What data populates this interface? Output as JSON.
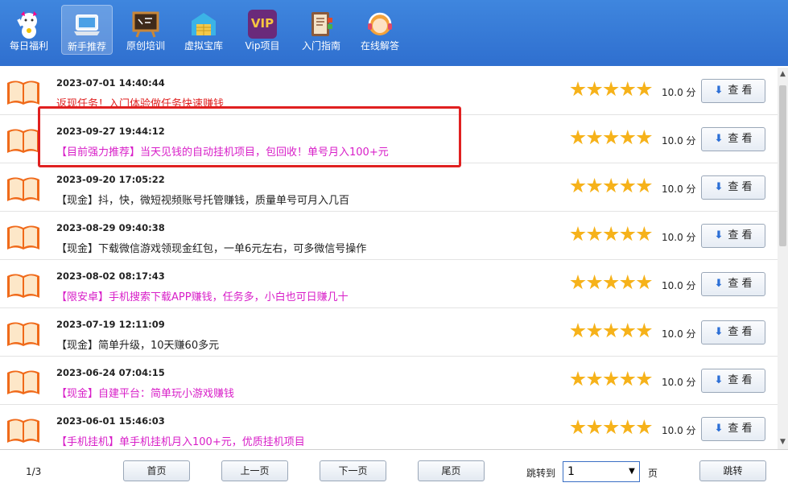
{
  "toolbar": {
    "items": [
      {
        "label": "每日福利",
        "icon": "lucky-cat-icon",
        "active": false
      },
      {
        "label": "新手推荐",
        "icon": "laptop-icon",
        "active": true
      },
      {
        "label": "原创培训",
        "icon": "chalkboard-icon",
        "active": false
      },
      {
        "label": "虚拟宝库",
        "icon": "warehouse-icon",
        "active": false
      },
      {
        "label": "Vip项目",
        "icon": "vip-icon",
        "active": false,
        "icon_text": "VIP"
      },
      {
        "label": "入门指南",
        "icon": "guide-book-icon",
        "active": false
      },
      {
        "label": "在线解答",
        "icon": "support-agent-icon",
        "active": false
      }
    ]
  },
  "list": {
    "rows": [
      {
        "date": "2023-07-01 14:40:44",
        "title": "返现任务！入门体验做任务快速赚钱",
        "color": "#e02020",
        "score": "10.0 分",
        "view": "查 看",
        "rating": 5
      },
      {
        "date": "2023-09-27 19:44:12",
        "title": "【目前强力推荐】当天见钱的自动挂机项目，包回收！单号月入100+元",
        "color": "#d81ec8",
        "score": "10.0 分",
        "view": "查 看",
        "rating": 5
      },
      {
        "date": "2023-09-20 17:05:22",
        "title": "【现金】抖，快，微短视频账号托管赚钱，质量单号可月入几百",
        "color": "#222222",
        "score": "10.0 分",
        "view": "查 看",
        "rating": 5
      },
      {
        "date": "2023-08-29 09:40:38",
        "title": "【现金】下载微信游戏领现金红包，一单6元左右，可多微信号操作",
        "color": "#222222",
        "score": "10.0 分",
        "view": "查 看",
        "rating": 5
      },
      {
        "date": "2023-08-02 08:17:43",
        "title": "【限安卓】手机搜索下载APP赚钱，任务多，小白也可日赚几十",
        "color": "#d81ec8",
        "score": "10.0 分",
        "view": "查 看",
        "rating": 5
      },
      {
        "date": "2023-07-19 12:11:09",
        "title": "【现金】简单升级，10天赚60多元",
        "color": "#222222",
        "score": "10.0 分",
        "view": "查 看",
        "rating": 5
      },
      {
        "date": "2023-06-24 07:04:15",
        "title": "【现金】自建平台：简单玩小游戏赚钱",
        "color": "#d81ec8",
        "score": "10.0 分",
        "view": "查 看",
        "rating": 5
      },
      {
        "date": "2023-06-01 15:46:03",
        "title": "【手机挂机】单手机挂机月入100+元，优质挂机项目",
        "color": "#d81ec8",
        "score": "10.0 分",
        "view": "查 看",
        "rating": 5
      }
    ]
  },
  "footer": {
    "page_info": "1/3",
    "first": "首页",
    "prev": "上一页",
    "next": "下一页",
    "last": "尾页",
    "jump_label": "跳转到",
    "jump_value": "1",
    "page_unit": "页",
    "jump_button": "跳转"
  },
  "colors": {
    "toolbar": "#3a7ed8",
    "star": "#f6b21a",
    "highlight": "#e02020"
  }
}
